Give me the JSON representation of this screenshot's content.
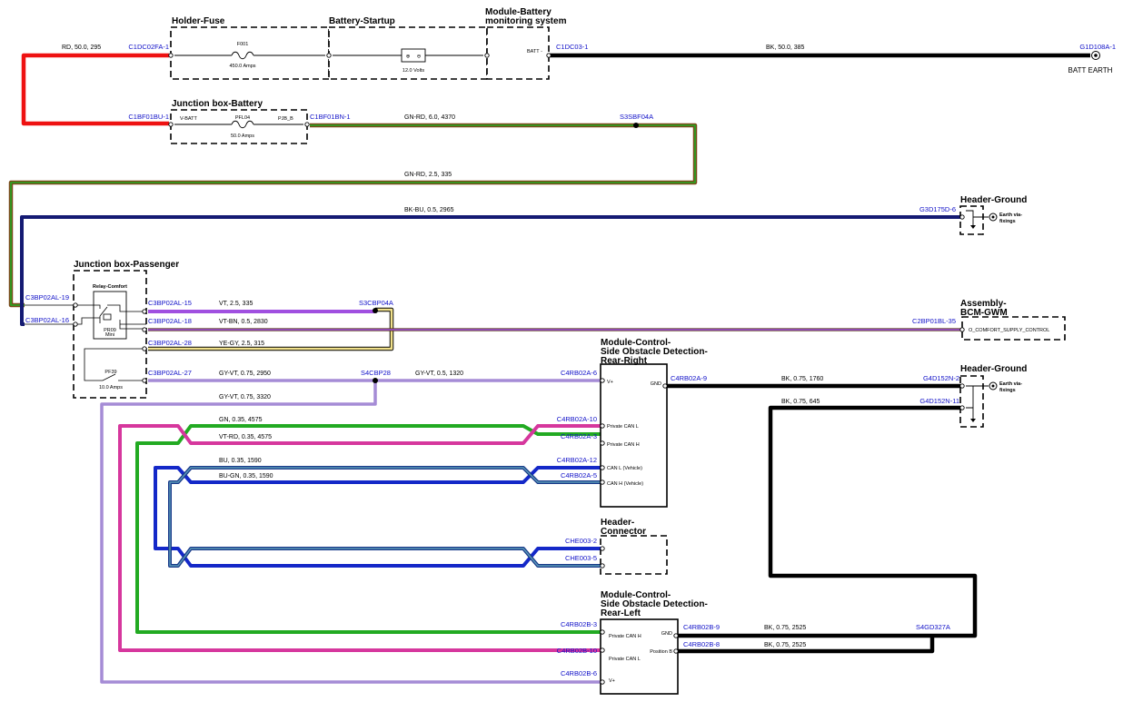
{
  "colors": {
    "red": "#ee1111",
    "black": "#000000",
    "green": "#22aa22",
    "brown": "#7a4a1a",
    "navy": "#141a73",
    "violet": "#a050e0",
    "lavender": "#a58cd6",
    "magenta": "#d6379d",
    "blue": "#1428c8",
    "lightblue": "#5a9ab8",
    "yellow": "#f0e08a",
    "connector": "#1010c8"
  },
  "components": {
    "holder_fuse": "Holder-Fuse",
    "battery_startup": "Battery-Startup",
    "module_battery": [
      "Module-Battery",
      "monitoring system"
    ],
    "jb_battery": "Junction box-Battery",
    "header_ground_1": "Header-Ground",
    "jb_passenger": "Junction box-Passenger",
    "assembly_bcm": [
      "Assembly-",
      "BCM-GWM"
    ],
    "sod_right": [
      "Module-Control-",
      "Side Obstacle Detection-",
      "Rear-Right"
    ],
    "header_ground_2": "Header-Ground",
    "header_connector": [
      "Header-",
      "Connector"
    ],
    "sod_left": [
      "Module-Control-",
      "Side Obstacle Detection-",
      "Rear-Left"
    ]
  },
  "labels": {
    "f001": "F001",
    "f001_amps": "450.0 Amps",
    "battery_volts": "12.0 Volts",
    "batt_minus": "BATT -",
    "batt_earth": "BATT EARTH",
    "vbatt": "V-BATT",
    "pfl04": "PFL04",
    "pjb_b": "PJB_B",
    "pfl04_amps": "50.0 Amps",
    "earth_fix": [
      "Earth via-",
      "fixings"
    ],
    "relay_comfort": "Relay-Comfort",
    "relay_sub": [
      "PR09",
      "Mini"
    ],
    "pf39": "PF39",
    "pf39_amps": "10.0 Amps",
    "bcm_pin": "O_COMFORT_SUPPLY_CONTROL",
    "r_vplus": "V+",
    "r_gnd": "GND",
    "r_pcanl": "Private CAN L",
    "r_pcanh": "Private CAN H",
    "r_canl": "CAN L (Vehicle)",
    "r_canh": "CAN H (Vehicle)",
    "l_pcanh": "Private CAN H",
    "l_pcanl": "Private CAN L",
    "l_gnd": "GND",
    "l_posb": "Position B",
    "l_vplus": "V+"
  },
  "connectors": {
    "c1dc02fa1": "C1DC02FA-1",
    "c1dc031": "C1DC03-1",
    "g1d108a1": "G1D108A-1",
    "c1bf01bu1": "C1BF01BU-1",
    "c1bf01bn1": "C1BF01BN-1",
    "s3sbf04a": "S3SBF04A",
    "g3d175d6": "G3D175D-6",
    "c3bp02al19": "C3BP02AL-19",
    "c3bp02al16": "C3BP02AL-16",
    "c3bp02al15": "C3BP02AL-15",
    "c3bp02al18": "C3BP02AL-18",
    "c3bp02al28": "C3BP02AL-28",
    "c3bp02al27": "C3BP02AL-27",
    "s3cbp04a": "S3CBP04A",
    "c2bp01bl35": "C2BP01BL-35",
    "s4cbp28": "S4CBP28",
    "c4rb02a6": "C4RB02A-6",
    "c4rb02a9": "C4RB02A-9",
    "g4d152n2": "G4D152N-2",
    "g4d152n11": "G4D152N-11",
    "c4rb02a10": "C4RB02A-10",
    "c4rb02a3": "C4RB02A-3",
    "c4rb02a12": "C4RB02A-12",
    "c4rb02a5": "C4RB02A-5",
    "che0032": "CHE003-2",
    "che0035": "CHE003-5",
    "c4rb02b3": "C4RB02B-3",
    "c4rb02b10": "C4RB02B-10",
    "c4rb02b6": "C4RB02B-6",
    "c4rb02b9": "C4RB02B-9",
    "c4rb02b8": "C4RB02B-8",
    "s4gd327a": "S4GD327A"
  },
  "wires": {
    "w_rd": "RD,  50.0,  295",
    "w_bk385": "BK,  50.0,  385",
    "w_gnrd4370": "GN-RD,  6.0,  4370",
    "w_gnrd335": "GN-RD,  2.5,  335",
    "w_bkbu": "BK-BU,  0.5,  2965",
    "w_vt": "VT,  2.5,  335",
    "w_vtbn": "VT-BN,  0.5,  2830",
    "w_yegy": "YE-GY,  2.5,  315",
    "w_gyvt2950": "GY-VT,  0.75,  2950",
    "w_gyvt1320": "GY-VT,  0.5,  1320",
    "w_gyvt3320": "GY-VT,  0.75,  3320",
    "w_bk1760": "BK,  0.75,  1760",
    "w_bk645": "BK,  0.75,  645",
    "w_gn": "GN,  0.35,  4575",
    "w_vtrd": "VT-RD,  0.35,  4575",
    "w_bu": "BU,  0.35,  1590",
    "w_bugn": "BU-GN,  0.35,  1590",
    "w_bk2525a": "BK,  0.75,  2525",
    "w_bk2525b": "BK,  0.75,  2525"
  }
}
